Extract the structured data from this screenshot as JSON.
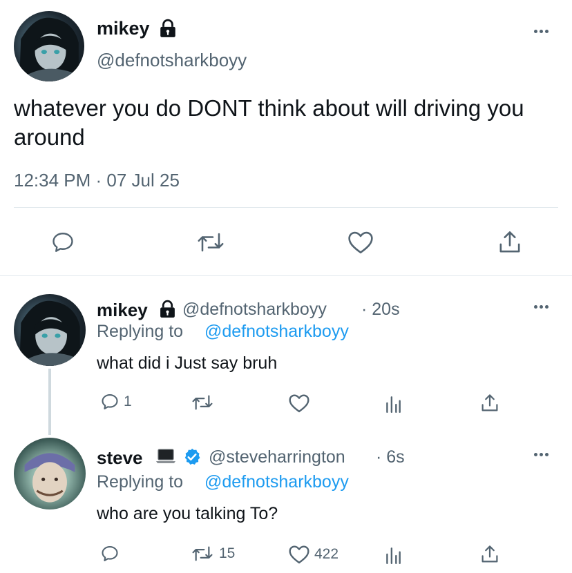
{
  "main_tweet": {
    "display_name": "mikey",
    "handle": "@defnotsharkboyy",
    "text": "whatever you do DONT think about will driving you around",
    "timestamp": "12:34 PM · 07 Jul 25",
    "icons": [
      "lock-icon",
      "more-icon",
      "reply-icon",
      "retweet-icon",
      "like-icon",
      "share-icon"
    ]
  },
  "replies": [
    {
      "display_name": "mikey",
      "handle": "@defnotsharkboyy",
      "time": "· 20s",
      "replying_label": "Replying to",
      "replying_to": "@defnotsharkboyy",
      "text": "what did i Just say bruh",
      "reply_count": "1",
      "retweet_count": "",
      "like_count": ""
    },
    {
      "display_name": "steve",
      "handle": "@steveharrington",
      "time": "· 6s",
      "replying_label": "Replying to",
      "replying_to": "@defnotsharkboyy",
      "text": "who are you talking To?",
      "reply_count": "",
      "retweet_count": "15",
      "like_count": "422"
    }
  ],
  "colors": {
    "text": "#0f1419",
    "secondary": "#536471",
    "link": "#1d9bf0",
    "divider": "#e1e8ed"
  }
}
